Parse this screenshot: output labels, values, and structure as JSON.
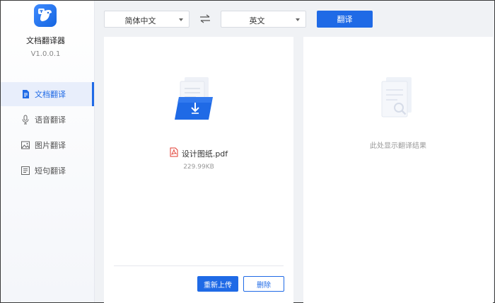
{
  "app": {
    "name": "文档翻译器",
    "version": "V1.0.0.1"
  },
  "sidebar": {
    "items": [
      {
        "label": "文档翻译",
        "icon": "document-icon",
        "active": true
      },
      {
        "label": "语音翻译",
        "icon": "microphone-icon",
        "active": false
      },
      {
        "label": "图片翻译",
        "icon": "image-icon",
        "active": false
      },
      {
        "label": "短句翻译",
        "icon": "text-lines-icon",
        "active": false
      }
    ]
  },
  "toolbar": {
    "source_language": "简体中文",
    "target_language": "英文",
    "translate_label": "翻译",
    "swap_icon": "swap-arrows-icon"
  },
  "source_panel": {
    "file_name": "设计图纸.pdf",
    "file_size": "229.99KB",
    "file_icon": "pdf-icon",
    "reupload_label": "重新上传",
    "delete_label": "删除"
  },
  "result_panel": {
    "placeholder": "此处显示翻译结果"
  },
  "colors": {
    "accent": "#1f6ae6",
    "sidebar_active_bg": "#e8eefb",
    "page_bg": "#f0f2f5"
  }
}
